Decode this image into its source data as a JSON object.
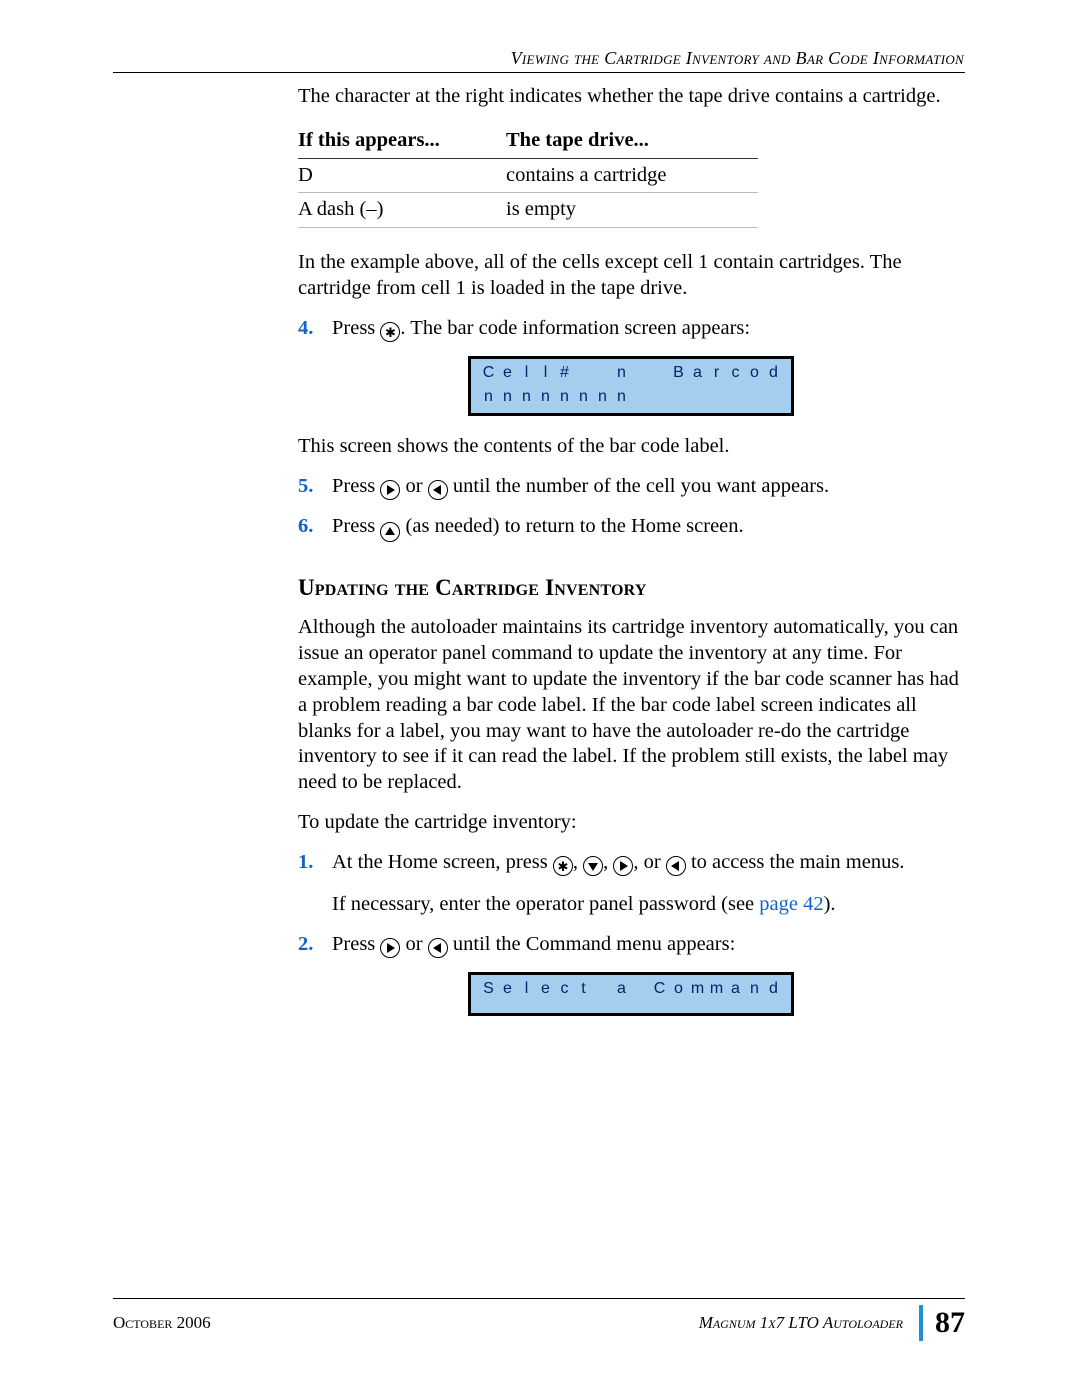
{
  "header": {
    "running": "Viewing the Cartridge Inventory and Bar Code Information"
  },
  "intro_para": "The character at the right indicates whether the tape drive contains a cartridge.",
  "status_table": {
    "headers": [
      "If this appears...",
      "The tape drive..."
    ],
    "rows": [
      [
        "D",
        "contains a cartridge"
      ],
      [
        "A dash (–)",
        "is empty"
      ]
    ]
  },
  "post_table_para": "In the example above, all of the cells except cell 1 contain cartridges. The cartridge from cell 1 is loaded in the tape drive.",
  "step4": {
    "num": "4.",
    "pre": "Press ",
    "post": ". The bar code information screen appears:"
  },
  "lcd1": {
    "line1": "Cell#  n  Barcode",
    "line2": "nnnnnnnn         "
  },
  "after_lcd1": "This screen shows the contents of the bar code label.",
  "step5": {
    "num": "5.",
    "pre": "Press ",
    "mid": " or ",
    "post": " until the number of the cell you want appears."
  },
  "step6": {
    "num": "6.",
    "pre": "Press ",
    "post": " (as needed) to return to the Home screen."
  },
  "subheading": "Updating the Cartridge Inventory",
  "update_para1": "Although the autoloader maintains its cartridge inventory automatically, you can issue an operator panel command to update the inventory at any time. For example, you might want to update the inventory if the bar code scanner has had a problem reading a bar code label. If the bar code label screen indicates all blanks for a label, you may want to have the autoloader re-do the cartridge inventory to see if it can read the label. If the problem still exists, the label may need to be replaced.",
  "update_para2": "To update the cartridge inventory:",
  "ustep1": {
    "num": "1.",
    "pre": "At the Home screen, press ",
    "sep": ", ",
    "or": ", or ",
    "post": " to access the main menus.",
    "line2a": "If necessary, enter the operator panel password (see ",
    "link": "page 42",
    "line2b": ")."
  },
  "ustep2": {
    "num": "2.",
    "pre": "Press ",
    "mid": " or ",
    "post": " until the Command menu appears:"
  },
  "lcd2": {
    "line1": "Select a Command",
    "line2": "                "
  },
  "footer": {
    "date": "October 2006",
    "product": "Magnum 1x7 LTO Autoloader",
    "page": "87"
  }
}
